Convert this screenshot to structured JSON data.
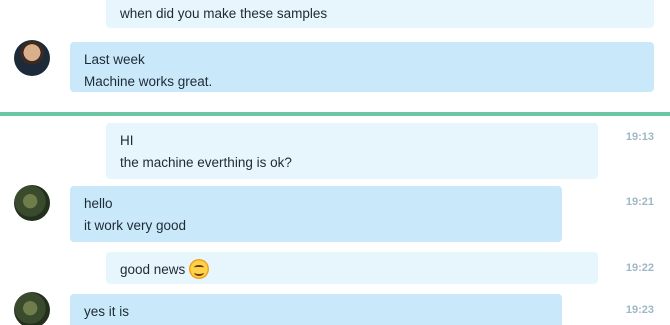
{
  "history": {
    "messages": [
      {
        "lines": [
          "when did you make these samples"
        ]
      },
      {
        "lines": [
          "Last week",
          "Machine works great."
        ]
      }
    ]
  },
  "chat": {
    "messages": [
      {
        "lines": [
          "HI",
          "the machine everthing is ok?"
        ],
        "time": "19:13"
      },
      {
        "lines": [
          "hello",
          "it work very good"
        ],
        "time": "19:21"
      },
      {
        "text": "good news",
        "emoji": "smiley-face-icon",
        "time": "19:22"
      },
      {
        "lines": [
          "yes it is"
        ],
        "time": "19:23"
      }
    ]
  },
  "colors": {
    "outgoing_bubble": "#e7f5fd",
    "incoming_bubble": "#c9e9fb",
    "divider": "#6cc6a4",
    "timestamp": "#9fb8c6"
  }
}
